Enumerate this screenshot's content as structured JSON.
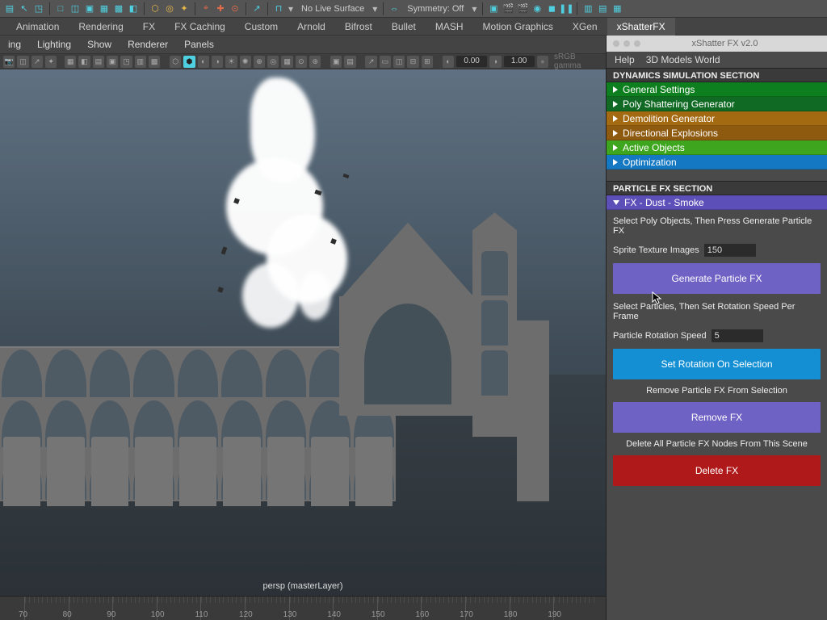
{
  "shelf": {
    "live_surface": "No Live Surface",
    "symmetry": "Symmetry: Off"
  },
  "menus": {
    "items": [
      "Animation",
      "Rendering",
      "FX",
      "FX Caching",
      "Custom",
      "Arnold",
      "Bifrost",
      "Bullet",
      "MASH",
      "Motion Graphics",
      "XGen",
      "xShatterFX"
    ],
    "active_index": 11
  },
  "viewport_menu": {
    "items": [
      "ing",
      "Lighting",
      "Show",
      "Renderer",
      "Panels"
    ]
  },
  "vp_toolbar": {
    "num1": "0.00",
    "num2": "1.00",
    "gamma": "sRGB gamma"
  },
  "viewport": {
    "label": "persp (masterLayer)"
  },
  "timeline": {
    "ticks": [
      "70",
      "80",
      "90",
      "100",
      "110",
      "120",
      "130",
      "140",
      "150",
      "160",
      "170",
      "180",
      "190"
    ]
  },
  "panel": {
    "title": "xShatter FX v2.0",
    "menu": [
      "Help",
      "3D Models World"
    ],
    "section1": "DYNAMICS SIMULATION SECTION",
    "accordions": [
      {
        "label": "General Settings",
        "cls": "c-green"
      },
      {
        "label": "Poly Shattering Generator",
        "cls": "c-dgreen"
      },
      {
        "label": "Demolition Generator",
        "cls": "c-orange"
      },
      {
        "label": "Directional Explosions",
        "cls": "c-dorange"
      },
      {
        "label": "Active Objects",
        "cls": "c-lgreen"
      },
      {
        "label": "Optimization",
        "cls": "c-blue"
      }
    ],
    "section2": "PARTICLE FX SECTION",
    "fx_header": "FX - Dust - Smoke",
    "fx": {
      "hint1": "Select Poly Objects, Then Press Generate Particle FX",
      "sprite_label": "Sprite Texture Images",
      "sprite_value": "150",
      "btn_generate": "Generate Particle FX",
      "hint2": "Select Particles, Then Set Rotation Speed Per Frame",
      "rot_label": "Particle Rotation Speed",
      "rot_value": "5",
      "btn_setrot": "Set Rotation On Selection",
      "hint3": "Remove Particle FX From Selection",
      "btn_remove": "Remove FX",
      "hint4": "Delete All Particle FX Nodes From This Scene",
      "btn_delete": "Delete FX"
    }
  }
}
